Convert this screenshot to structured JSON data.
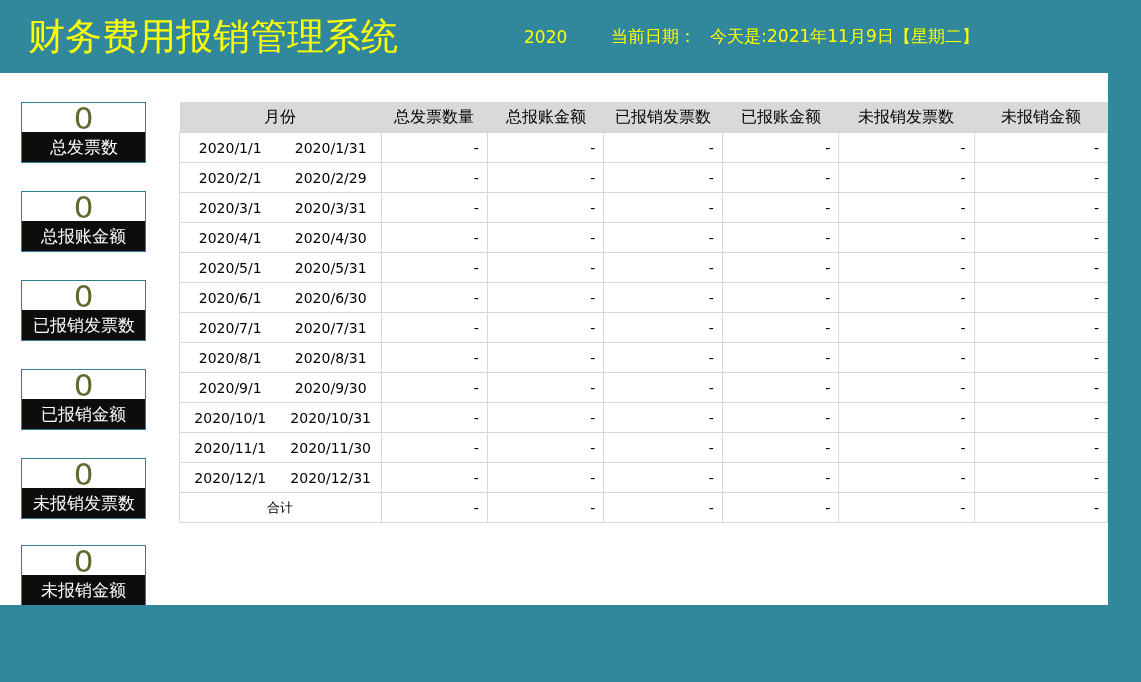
{
  "header": {
    "title": "财务费用报销管理系统",
    "year": "2020",
    "date_label": "当前日期：",
    "date_value": "今天是:2021年11月9日【星期二】"
  },
  "cards": [
    {
      "value": "0",
      "label": "总发票数"
    },
    {
      "value": "0",
      "label": "总报账金额"
    },
    {
      "value": "0",
      "label": "已报销发票数"
    },
    {
      "value": "0",
      "label": "已报销金额"
    },
    {
      "value": "0",
      "label": "未报销发票数"
    },
    {
      "value": "0",
      "label": "未报销金额"
    }
  ],
  "table": {
    "columns": [
      "月份",
      "总发票数量",
      "总报账金额",
      "已报销发票数",
      "已报账金额",
      "未报销发票数",
      "未报销金额"
    ],
    "rows": [
      {
        "start": "2020/1/1",
        "end": "2020/1/31",
        "values": [
          "-",
          "-",
          "-",
          "-",
          "-",
          "-"
        ]
      },
      {
        "start": "2020/2/1",
        "end": "2020/2/29",
        "values": [
          "-",
          "-",
          "-",
          "-",
          "-",
          "-"
        ]
      },
      {
        "start": "2020/3/1",
        "end": "2020/3/31",
        "values": [
          "-",
          "-",
          "-",
          "-",
          "-",
          "-"
        ]
      },
      {
        "start": "2020/4/1",
        "end": "2020/4/30",
        "values": [
          "-",
          "-",
          "-",
          "-",
          "-",
          "-"
        ]
      },
      {
        "start": "2020/5/1",
        "end": "2020/5/31",
        "values": [
          "-",
          "-",
          "-",
          "-",
          "-",
          "-"
        ]
      },
      {
        "start": "2020/6/1",
        "end": "2020/6/30",
        "values": [
          "-",
          "-",
          "-",
          "-",
          "-",
          "-"
        ]
      },
      {
        "start": "2020/7/1",
        "end": "2020/7/31",
        "values": [
          "-",
          "-",
          "-",
          "-",
          "-",
          "-"
        ]
      },
      {
        "start": "2020/8/1",
        "end": "2020/8/31",
        "values": [
          "-",
          "-",
          "-",
          "-",
          "-",
          "-"
        ]
      },
      {
        "start": "2020/9/1",
        "end": "2020/9/30",
        "values": [
          "-",
          "-",
          "-",
          "-",
          "-",
          "-"
        ]
      },
      {
        "start": "2020/10/1",
        "end": "2020/10/31",
        "values": [
          "-",
          "-",
          "-",
          "-",
          "-",
          "-"
        ]
      },
      {
        "start": "2020/11/1",
        "end": "2020/11/30",
        "values": [
          "-",
          "-",
          "-",
          "-",
          "-",
          "-"
        ]
      },
      {
        "start": "2020/12/1",
        "end": "2020/12/31",
        "values": [
          "-",
          "-",
          "-",
          "-",
          "-",
          "-"
        ]
      }
    ],
    "total": {
      "label": "合计",
      "values": [
        "-",
        "-",
        "-",
        "-",
        "-",
        "-"
      ]
    }
  }
}
